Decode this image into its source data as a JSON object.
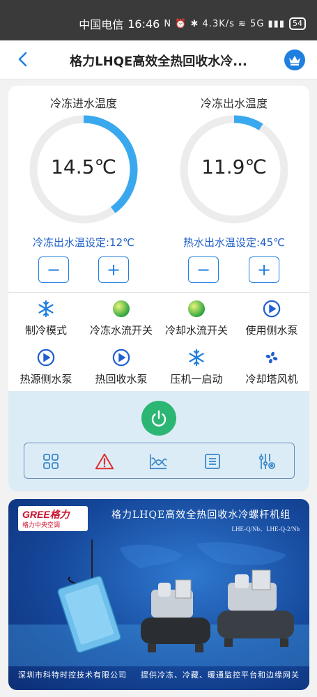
{
  "status_bar": {
    "carrier": "中国电信",
    "time": "16:46",
    "indicators": "N ⏰ ✱ 4.3K/s ≋ 5G ▮▮▮",
    "battery": "54"
  },
  "nav": {
    "title": "格力LHQE高效全热回收水冷..."
  },
  "gauges": [
    {
      "label": "冷冻进水温度",
      "value": "14.5℃",
      "fill_fraction": 0.4
    },
    {
      "label": "冷冻出水温度",
      "value": "11.9℃",
      "fill_fraction": 0.09
    }
  ],
  "setpoints": [
    {
      "text": "冷冻出水温设定:12℃"
    },
    {
      "text": "热水出水温设定:45℃"
    }
  ],
  "buttons": {
    "minus": "−",
    "plus": "+"
  },
  "status_items": [
    {
      "label": "制冷模式",
      "icon": "snowflake-icon"
    },
    {
      "label": "冷冻水流开关",
      "icon": "green-indicator-icon"
    },
    {
      "label": "冷却水流开关",
      "icon": "green-indicator-icon"
    },
    {
      "label": "使用侧水泵",
      "icon": "pump-icon"
    },
    {
      "label": "热源侧水泵",
      "icon": "pump-icon"
    },
    {
      "label": "热回收水泵",
      "icon": "pump-icon"
    },
    {
      "label": "压机一启动",
      "icon": "snowflake-icon"
    },
    {
      "label": "冷却塔风机",
      "icon": "fan-icon"
    }
  ],
  "toolbar": [
    {
      "icon": "grid-icon"
    },
    {
      "icon": "warning-icon"
    },
    {
      "icon": "trend-chart-icon"
    },
    {
      "icon": "list-icon"
    },
    {
      "icon": "settings-sliders-icon"
    }
  ],
  "banner": {
    "logo": "GREE格力",
    "logo_sub": "格力中央空调",
    "title": "格力LHQE高效全热回收水冷螺杆机组",
    "model": "LHE-Q/Nb、LHE-Q-2/Nb",
    "company": "深圳市科特时控技术有限公司",
    "slogan": "提供冷冻、冷藏、暖通监控平台和边缘网关"
  },
  "colors": {
    "accent": "#1f7fe0",
    "gauge_track": "#ececec",
    "gauge_fill": "#3aa8ee",
    "setpoint_text": "#1e5fc8",
    "power": "#2bb673",
    "warning": "#e03030",
    "panel_bg": "#dcecf7"
  }
}
